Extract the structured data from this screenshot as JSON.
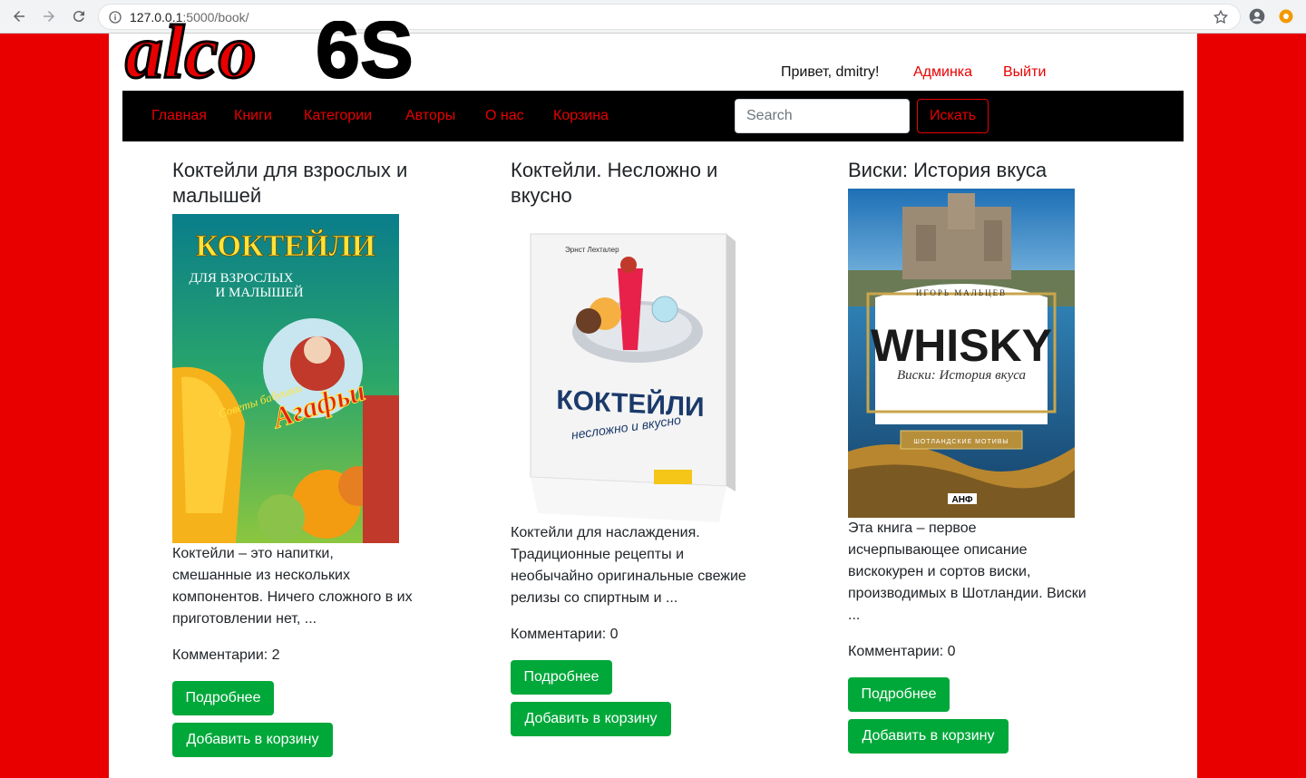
{
  "browser": {
    "url_host": "127.0.0.1",
    "url_path": ":5000/book/"
  },
  "header": {
    "logo_text": "alco 6S",
    "greeting": "Привет, dmitry!",
    "admin_link": "Админка",
    "logout_link": "Выйти"
  },
  "nav": {
    "items": [
      "Главная",
      "Книги",
      "Категории",
      "Авторы",
      "О нас",
      "Корзина"
    ],
    "search_placeholder": "Search",
    "search_button": "Искать"
  },
  "books": [
    {
      "title": "Коктейли для взрослых и малышей",
      "cover_text": [
        "КОКТЕЙЛИ",
        "ДЛЯ ВЗРОСЛЫХ",
        "И МАЛЫШЕЙ",
        "Советы бабушки",
        "Агафьи"
      ],
      "description": "Коктейли – это напитки, смешанные из нескольких компонентов. Ничего сложного в их приготовлении нет, ...",
      "comments": "Комментарии: 2",
      "details_button": "Подробнее",
      "cart_button": "Добавить в корзину"
    },
    {
      "title": "Коктейли. Несложно и вкусно",
      "cover_text": [
        "Эрнст Лехталер",
        "КОКТЕЙЛИ",
        "несложно и вкусно"
      ],
      "description": "Коктейли для наслаждения. Традиционные рецепты и необычайно оригинальные свежие релизы со спиртным и ...",
      "comments": "Комментарии: 0",
      "details_button": "Подробнее",
      "cart_button": "Добавить в корзину"
    },
    {
      "title": "Виски: История вкуса",
      "cover_text": [
        "ИГОРЬ МАЛЬЦЕВ",
        "WHISKY",
        "Виски: История вкуса",
        "ШОТЛАНДСКИЕ МОТИВЫ",
        "АНФ"
      ],
      "description": "Эта книга – первое исчерпывающее описание вискокурен и сортов виски, производимых в Шотландии. Виски ...",
      "comments": "Комментарии: 0",
      "details_button": "Подробнее",
      "cart_button": "Добавить в корзину"
    }
  ],
  "colors": {
    "page_bg": "#e80000",
    "link": "#e80000",
    "navbar": "#000000",
    "button": "#00a83a"
  }
}
